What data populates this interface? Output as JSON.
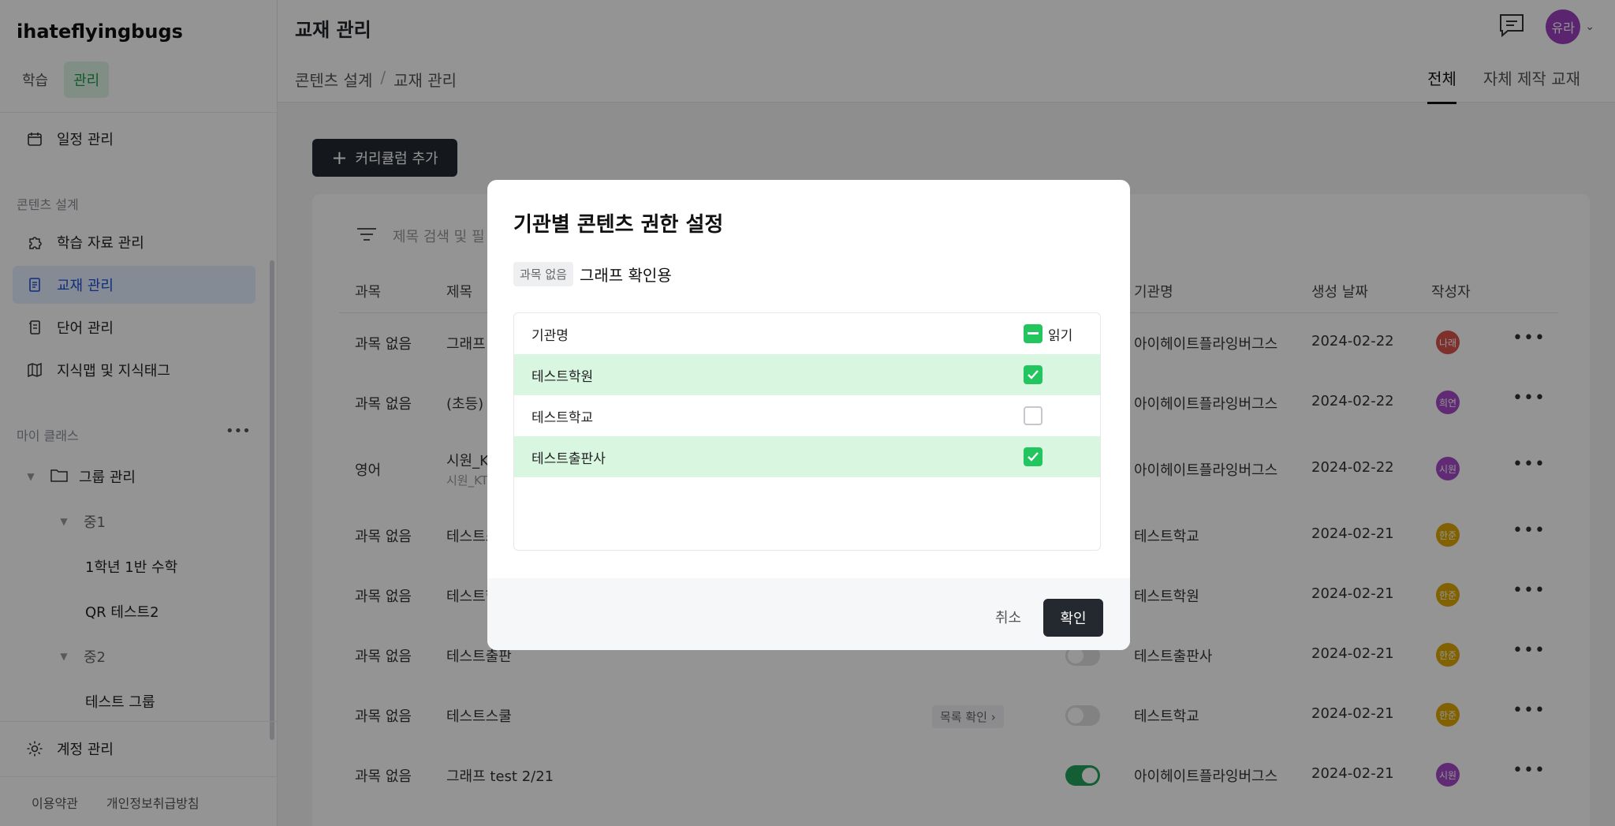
{
  "sidebar": {
    "brand": "ihateflyingbugs",
    "top_nav": [
      "학습",
      "관리"
    ],
    "schedule": "일정 관리",
    "section_content": "콘텐츠 설계",
    "content_items": [
      "학습 자료 관리",
      "교재 관리",
      "단어 관리",
      "지식맵 및 지식태그"
    ],
    "section_class": "마이 클래스",
    "tree": {
      "group": "그룹 관리",
      "mid1": "중1",
      "class1": "1학년 1반 수학",
      "class2": "QR 테스트2",
      "mid2": "중2",
      "class3": "테스트 그룹"
    },
    "account": "계정 관리",
    "footer": [
      "이용약관",
      "개인정보취급방침"
    ]
  },
  "header": {
    "title": "교재 관리",
    "breadcrumb": [
      "콘텐츠 설계",
      "교재 관리"
    ],
    "avatar": "유라",
    "tabs": [
      "전체",
      "자체 제작 교재"
    ]
  },
  "toolbar": {
    "add_label": "커리큘럼 추가"
  },
  "filter": {
    "placeholder": "제목 검색 및 필"
  },
  "table": {
    "headers": {
      "subject": "과목",
      "title": "제목",
      "org": "기관명",
      "date": "생성 날짜",
      "author": "작성자"
    },
    "rows": [
      {
        "subject": "과목 없음",
        "title": "그래프 ",
        "org": "아이헤이트플라잉버그스",
        "date": "2024-02-22",
        "author": "나래",
        "color": "#d9534f"
      },
      {
        "subject": "과목 없음",
        "title": "(초등) S",
        "org": "아이헤이트플라잉버그스",
        "date": "2024-02-22",
        "author": "희연",
        "color": "#a64ac9"
      },
      {
        "subject": "영어",
        "title": "시원_KT",
        "sub": "시원_KT",
        "org": "아이헤이트플라잉버그스",
        "date": "2024-02-22",
        "author": "시원",
        "color": "#a64ac9"
      },
      {
        "subject": "과목 없음",
        "title": "테스트스",
        "org": "테스트학교",
        "date": "2024-02-21",
        "author": "한준",
        "color": "#e0a800"
      },
      {
        "subject": "과목 없음",
        "title": "테스트학",
        "org": "테스트학원",
        "date": "2024-02-21",
        "author": "한준",
        "color": "#e0a800"
      },
      {
        "subject": "과목 없음",
        "title": "테스트출판",
        "org": "테스트출판사",
        "date": "2024-02-21",
        "author": "한준",
        "color": "#e0a800"
      },
      {
        "subject": "과목 없음",
        "title": "테스트스쿨",
        "org": "테스트학교",
        "date": "2024-02-21",
        "author": "한준",
        "color": "#e0a800",
        "pill": "목록 확인 ›"
      },
      {
        "subject": "과목 없음",
        "title": "그래프 test 2/21",
        "org": "아이헤이트플라잉버그스",
        "date": "2024-02-21",
        "author": "시원",
        "color": "#a64ac9"
      }
    ]
  },
  "modal": {
    "title": "기관별 콘텐츠 권한 설정",
    "tag": "과목 없음",
    "content_name": "그래프 확인용",
    "col_org": "기관명",
    "col_read": "읽기",
    "orgs": [
      {
        "name": "테스트학원",
        "checked": true
      },
      {
        "name": "테스트학교",
        "checked": false
      },
      {
        "name": "테스트출판사",
        "checked": true
      }
    ],
    "cancel": "취소",
    "confirm": "확인"
  },
  "colors": {
    "accent": "#22c55e",
    "primary_dark": "#24292f",
    "selected_row": "#d9f6e0"
  }
}
